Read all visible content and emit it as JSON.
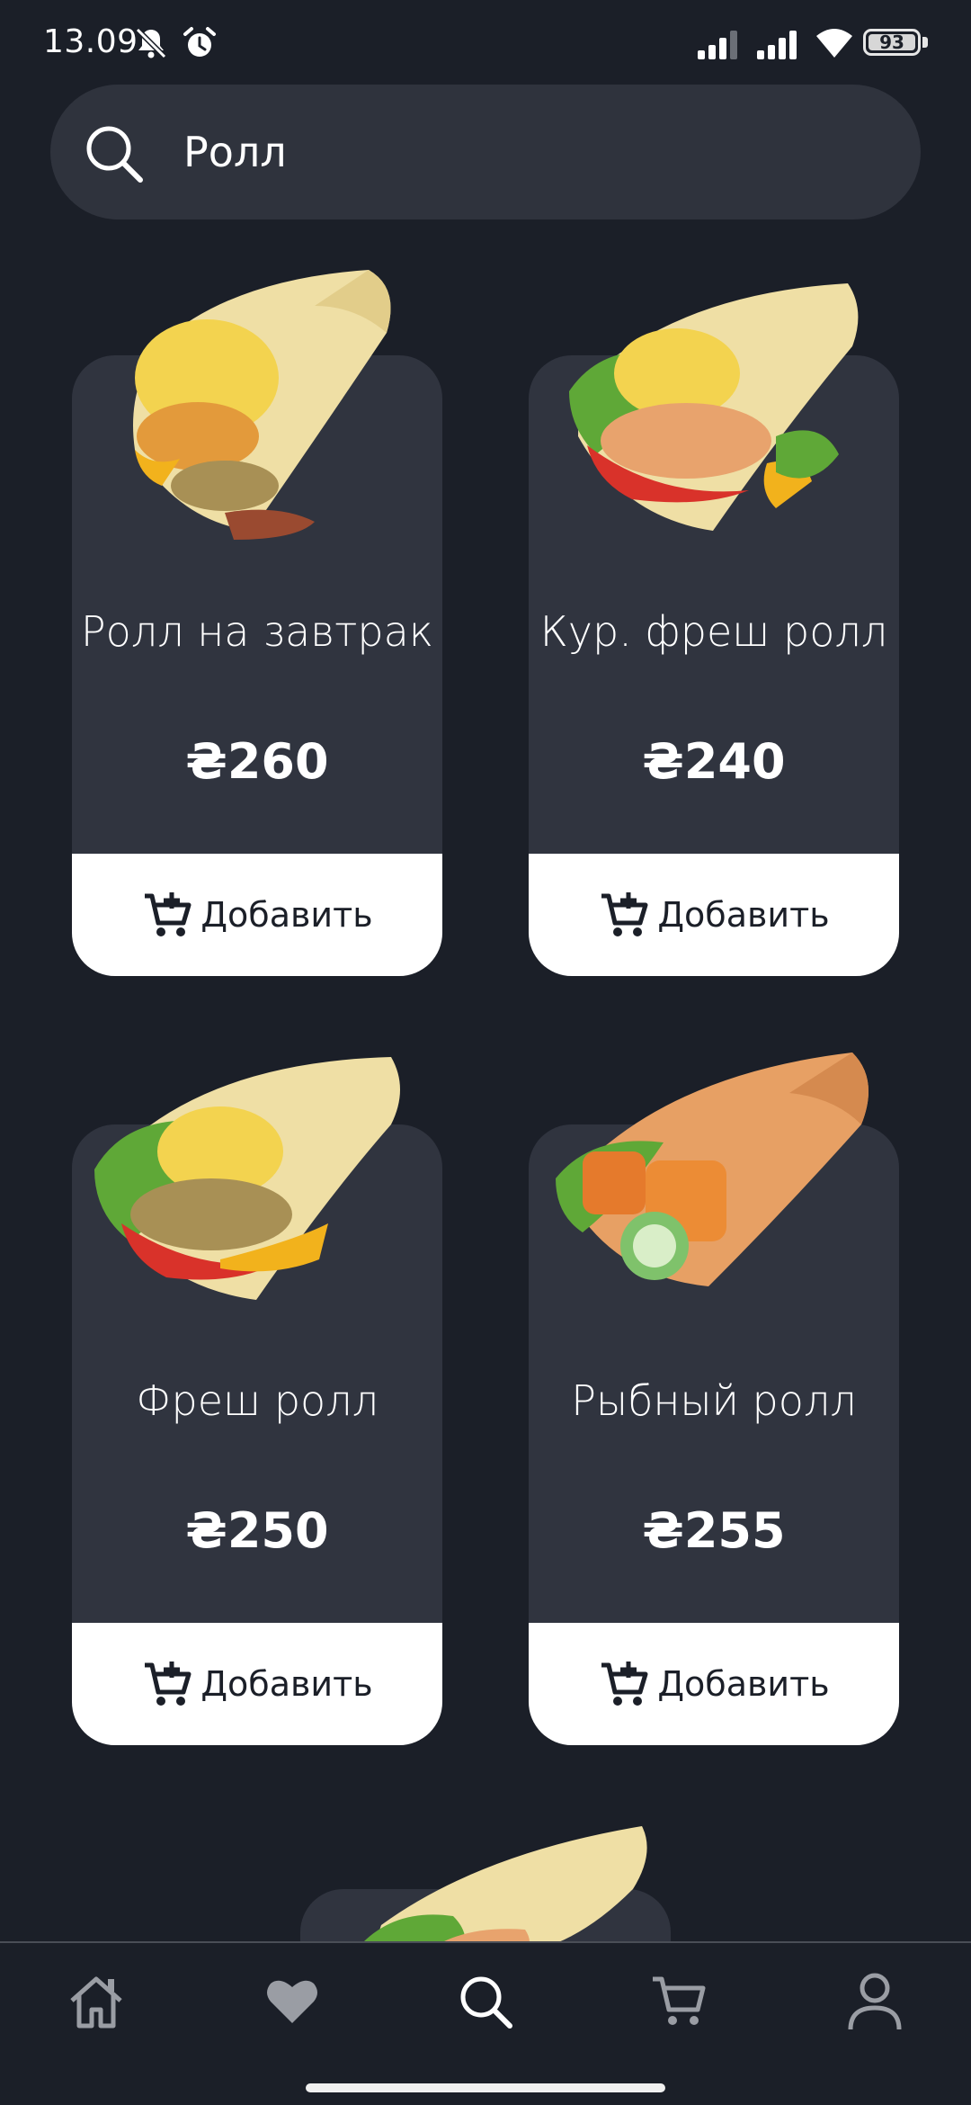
{
  "status_bar": {
    "time": "13.09",
    "battery": "93"
  },
  "search": {
    "value": "Ролл",
    "placeholder": ""
  },
  "currency": "₴",
  "products": [
    {
      "name": "Ролл на завтрак",
      "price": "₴260",
      "add_label": "Добавить"
    },
    {
      "name": "Кур. фреш ролл",
      "price": "₴240",
      "add_label": "Добавить"
    },
    {
      "name": "Фреш ролл",
      "price": "₴250",
      "add_label": "Добавить"
    },
    {
      "name": "Рыбный ролл",
      "price": "₴255",
      "add_label": "Добавить"
    }
  ],
  "bottom_nav": {
    "items": [
      "home-icon",
      "heart-icon",
      "search-icon",
      "cart-icon",
      "user-icon"
    ],
    "active": "search-icon"
  },
  "colors": {
    "background": "#1b1f28",
    "card": "#30343f",
    "search_bar": "#2f333d",
    "add_button": "#ffffff",
    "nav_inactive": "#9a9da4"
  }
}
